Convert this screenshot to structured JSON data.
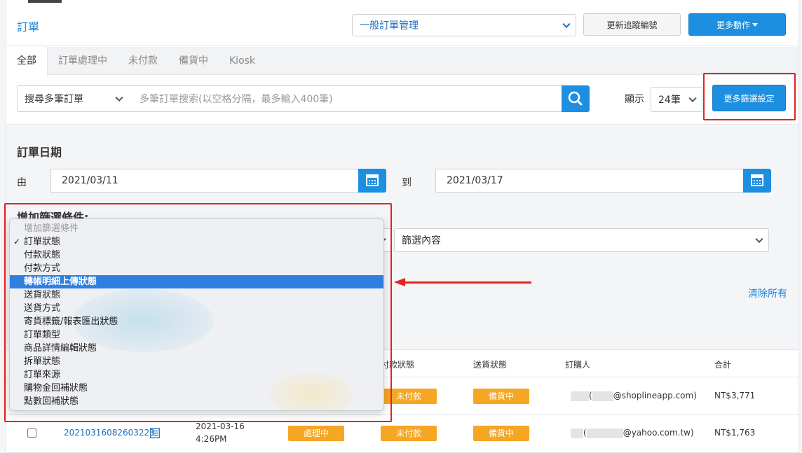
{
  "header": {
    "title": "訂單",
    "management_select": "一般訂單管理",
    "update_tracking_button": "更新追蹤編號",
    "more_actions_button": "更多動作"
  },
  "tabs": [
    {
      "label": "全部",
      "active": true
    },
    {
      "label": "訂單處理中",
      "active": false
    },
    {
      "label": "未付款",
      "active": false
    },
    {
      "label": "備貨中",
      "active": false
    },
    {
      "label": "Kiosk",
      "active": false
    }
  ],
  "search": {
    "type_select": "搜尋多筆訂單",
    "placeholder": "多筆訂單搜索(以空格分隔，最多輸入400筆)",
    "show_label": "顯示",
    "per_page": "24筆",
    "more_filter_button": "更多篩選設定"
  },
  "filters": {
    "date_title": "訂單日期",
    "from_label": "由",
    "from_date": "2021/03/11",
    "to_label": "到",
    "to_date": "2021/03/17",
    "add_condition_title": "增加篩選條件:",
    "filter_content_select": "篩選內容",
    "clear_all": "清除所有"
  },
  "dropdown": {
    "header": "增加篩選條件",
    "options": [
      {
        "label": "訂單狀態",
        "checked": true,
        "highlighted": false
      },
      {
        "label": "付款狀態",
        "checked": false,
        "highlighted": false
      },
      {
        "label": "付款方式",
        "checked": false,
        "highlighted": false
      },
      {
        "label": "轉帳明細上傳狀態",
        "checked": false,
        "highlighted": true
      },
      {
        "label": "送貨狀態",
        "checked": false,
        "highlighted": false
      },
      {
        "label": "送貨方式",
        "checked": false,
        "highlighted": false
      },
      {
        "label": "寄貨標籤/報表匯出狀態",
        "checked": false,
        "highlighted": false
      },
      {
        "label": "訂單類型",
        "checked": false,
        "highlighted": false
      },
      {
        "label": "商品詳情編輯狀態",
        "checked": false,
        "highlighted": false
      },
      {
        "label": "拆單狀態",
        "checked": false,
        "highlighted": false
      },
      {
        "label": "訂單來源",
        "checked": false,
        "highlighted": false
      },
      {
        "label": "購物金回補狀態",
        "checked": false,
        "highlighted": false
      },
      {
        "label": "點數回補狀態",
        "checked": false,
        "highlighted": false
      }
    ]
  },
  "table": {
    "columns": {
      "payment_status": "付款狀態",
      "delivery_status": "送貨狀態",
      "buyer": "訂購人",
      "total": "合計"
    },
    "rows": [
      {
        "order_number": "",
        "date": "",
        "time": "",
        "order_status": "",
        "payment_status": "未付款",
        "delivery_status": "備貨中",
        "buyer_domain": "@shoplineapp.com)",
        "buyer_paren": "(",
        "total": "NT$3,771"
      },
      {
        "order_number": "20210316082603223",
        "date": "2021-03-16",
        "time": "4:26PM",
        "order_status": "處理中",
        "payment_status": "未付款",
        "delivery_status": "備貨中",
        "buyer_domain": "@yahoo.com.tw)",
        "buyer_paren": "(",
        "total": "NT$1,763"
      }
    ]
  },
  "colors": {
    "primary": "#1d8fe1",
    "highlight_border": "#e32222",
    "badge": "#f5a623",
    "selected_option": "#2f7fe0"
  }
}
